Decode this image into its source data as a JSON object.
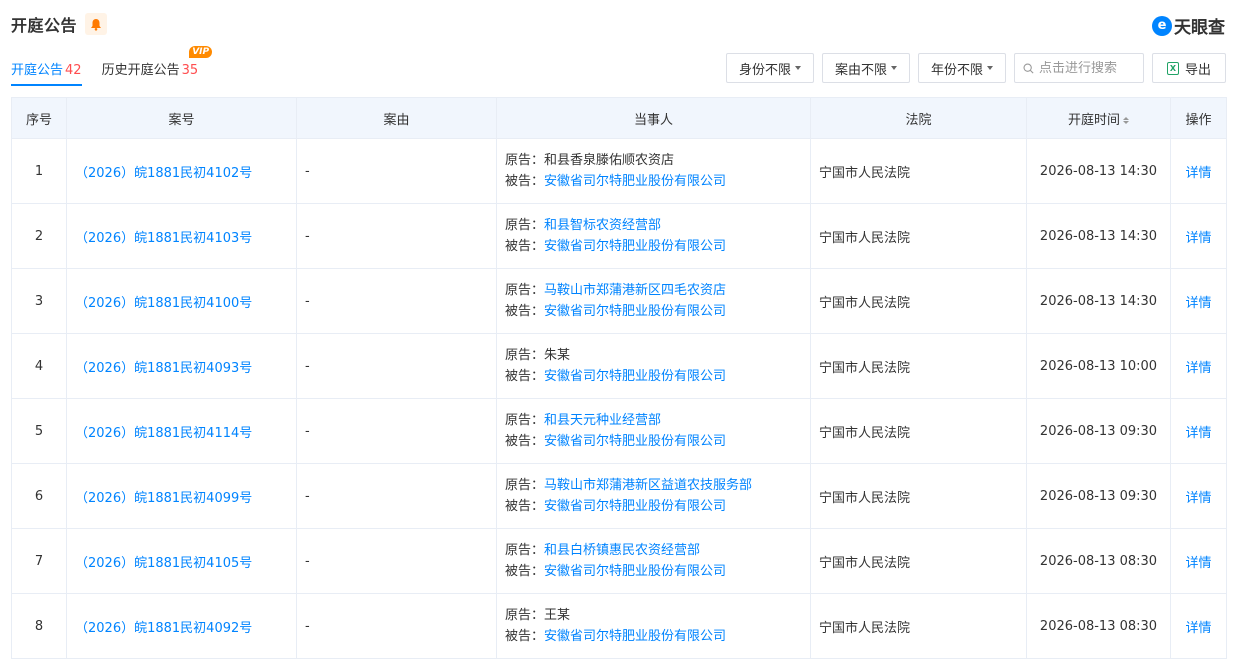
{
  "header": {
    "title": "开庭公告"
  },
  "logo": {
    "text": "天眼查"
  },
  "tabs": [
    {
      "label": "开庭公告",
      "count": "42"
    },
    {
      "label": "历史开庭公告",
      "count": "35",
      "badge": "VIP"
    }
  ],
  "filters": {
    "identity": "身份不限",
    "cause": "案由不限",
    "year": "年份不限",
    "search_placeholder": "点击进行搜索",
    "export_label": "导出"
  },
  "table": {
    "columns": [
      "序号",
      "案号",
      "案由",
      "当事人",
      "法院",
      "开庭时间",
      "操作"
    ],
    "rows": [
      {
        "no": "1",
        "case": "（2026）皖1881民初4102号",
        "cause": "-",
        "plaintiff_label": "原告：",
        "plaintiff": "和县香泉滕佑顺农资店",
        "plaintiff_link": false,
        "defendant_label": "被告：",
        "defendant": "安徽省司尔特肥业股份有限公司",
        "court": "宁国市人民法院",
        "time": "2026-08-13 14:30",
        "action": "详情"
      },
      {
        "no": "2",
        "case": "（2026）皖1881民初4103号",
        "cause": "-",
        "plaintiff_label": "原告：",
        "plaintiff": "和县智标农资经营部",
        "plaintiff_link": true,
        "defendant_label": "被告：",
        "defendant": "安徽省司尔特肥业股份有限公司",
        "court": "宁国市人民法院",
        "time": "2026-08-13 14:30",
        "action": "详情"
      },
      {
        "no": "3",
        "case": "（2026）皖1881民初4100号",
        "cause": "-",
        "plaintiff_label": "原告：",
        "plaintiff": "马鞍山市郑蒲港新区四毛农资店",
        "plaintiff_link": true,
        "defendant_label": "被告：",
        "defendant": "安徽省司尔特肥业股份有限公司",
        "court": "宁国市人民法院",
        "time": "2026-08-13 14:30",
        "action": "详情"
      },
      {
        "no": "4",
        "case": "（2026）皖1881民初4093号",
        "cause": "-",
        "plaintiff_label": "原告：",
        "plaintiff": "朱某",
        "plaintiff_link": false,
        "defendant_label": "被告：",
        "defendant": "安徽省司尔特肥业股份有限公司",
        "court": "宁国市人民法院",
        "time": "2026-08-13 10:00",
        "action": "详情"
      },
      {
        "no": "5",
        "case": "（2026）皖1881民初4114号",
        "cause": "-",
        "plaintiff_label": "原告：",
        "plaintiff": "和县天元种业经营部",
        "plaintiff_link": true,
        "defendant_label": "被告：",
        "defendant": "安徽省司尔特肥业股份有限公司",
        "court": "宁国市人民法院",
        "time": "2026-08-13 09:30",
        "action": "详情"
      },
      {
        "no": "6",
        "case": "（2026）皖1881民初4099号",
        "cause": "-",
        "plaintiff_label": "原告：",
        "plaintiff": "马鞍山市郑蒲港新区益道农技服务部",
        "plaintiff_link": true,
        "defendant_label": "被告：",
        "defendant": "安徽省司尔特肥业股份有限公司",
        "court": "宁国市人民法院",
        "time": "2026-08-13 09:30",
        "action": "详情"
      },
      {
        "no": "7",
        "case": "（2026）皖1881民初4105号",
        "cause": "-",
        "plaintiff_label": "原告：",
        "plaintiff": "和县白桥镇惠民农资经营部",
        "plaintiff_link": true,
        "defendant_label": "被告：",
        "defendant": "安徽省司尔特肥业股份有限公司",
        "court": "宁国市人民法院",
        "time": "2026-08-13 08:30",
        "action": "详情"
      },
      {
        "no": "8",
        "case": "（2026）皖1881民初4092号",
        "cause": "-",
        "plaintiff_label": "原告：",
        "plaintiff": "王某",
        "plaintiff_link": false,
        "defendant_label": "被告：",
        "defendant": "安徽省司尔特肥业股份有限公司",
        "court": "宁国市人民法院",
        "time": "2026-08-13 08:30",
        "action": "详情"
      }
    ]
  },
  "colors": {
    "accent": "#0084ff",
    "count": "#ff4d4f",
    "vip": "#ff8a00",
    "header_bg": "#f1f6fd"
  }
}
